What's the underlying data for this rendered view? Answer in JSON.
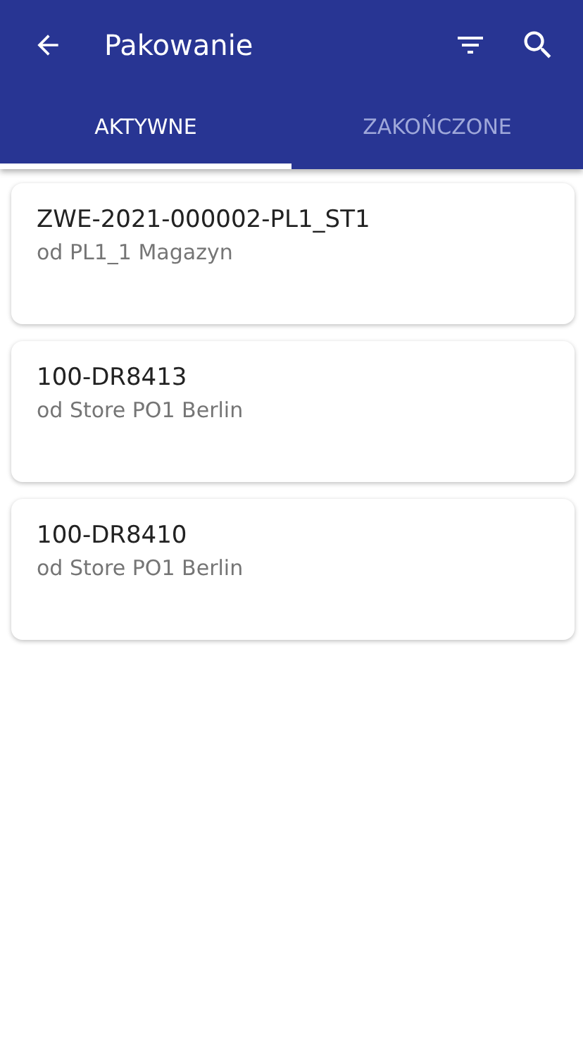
{
  "app_bar": {
    "title": "Pakowanie"
  },
  "tabs": [
    {
      "label": "AKTYWNE",
      "selected": true
    },
    {
      "label": "ZAKOŃCZONE",
      "selected": false
    }
  ],
  "cards": [
    {
      "title": "ZWE-2021-000002-PL1_ST1",
      "subtitle": "od PL1_1 Magazyn"
    },
    {
      "title": "100-DR8413",
      "subtitle": "od Store PO1 Berlin"
    },
    {
      "title": "100-DR8410",
      "subtitle": "od Store PO1 Berlin"
    }
  ]
}
